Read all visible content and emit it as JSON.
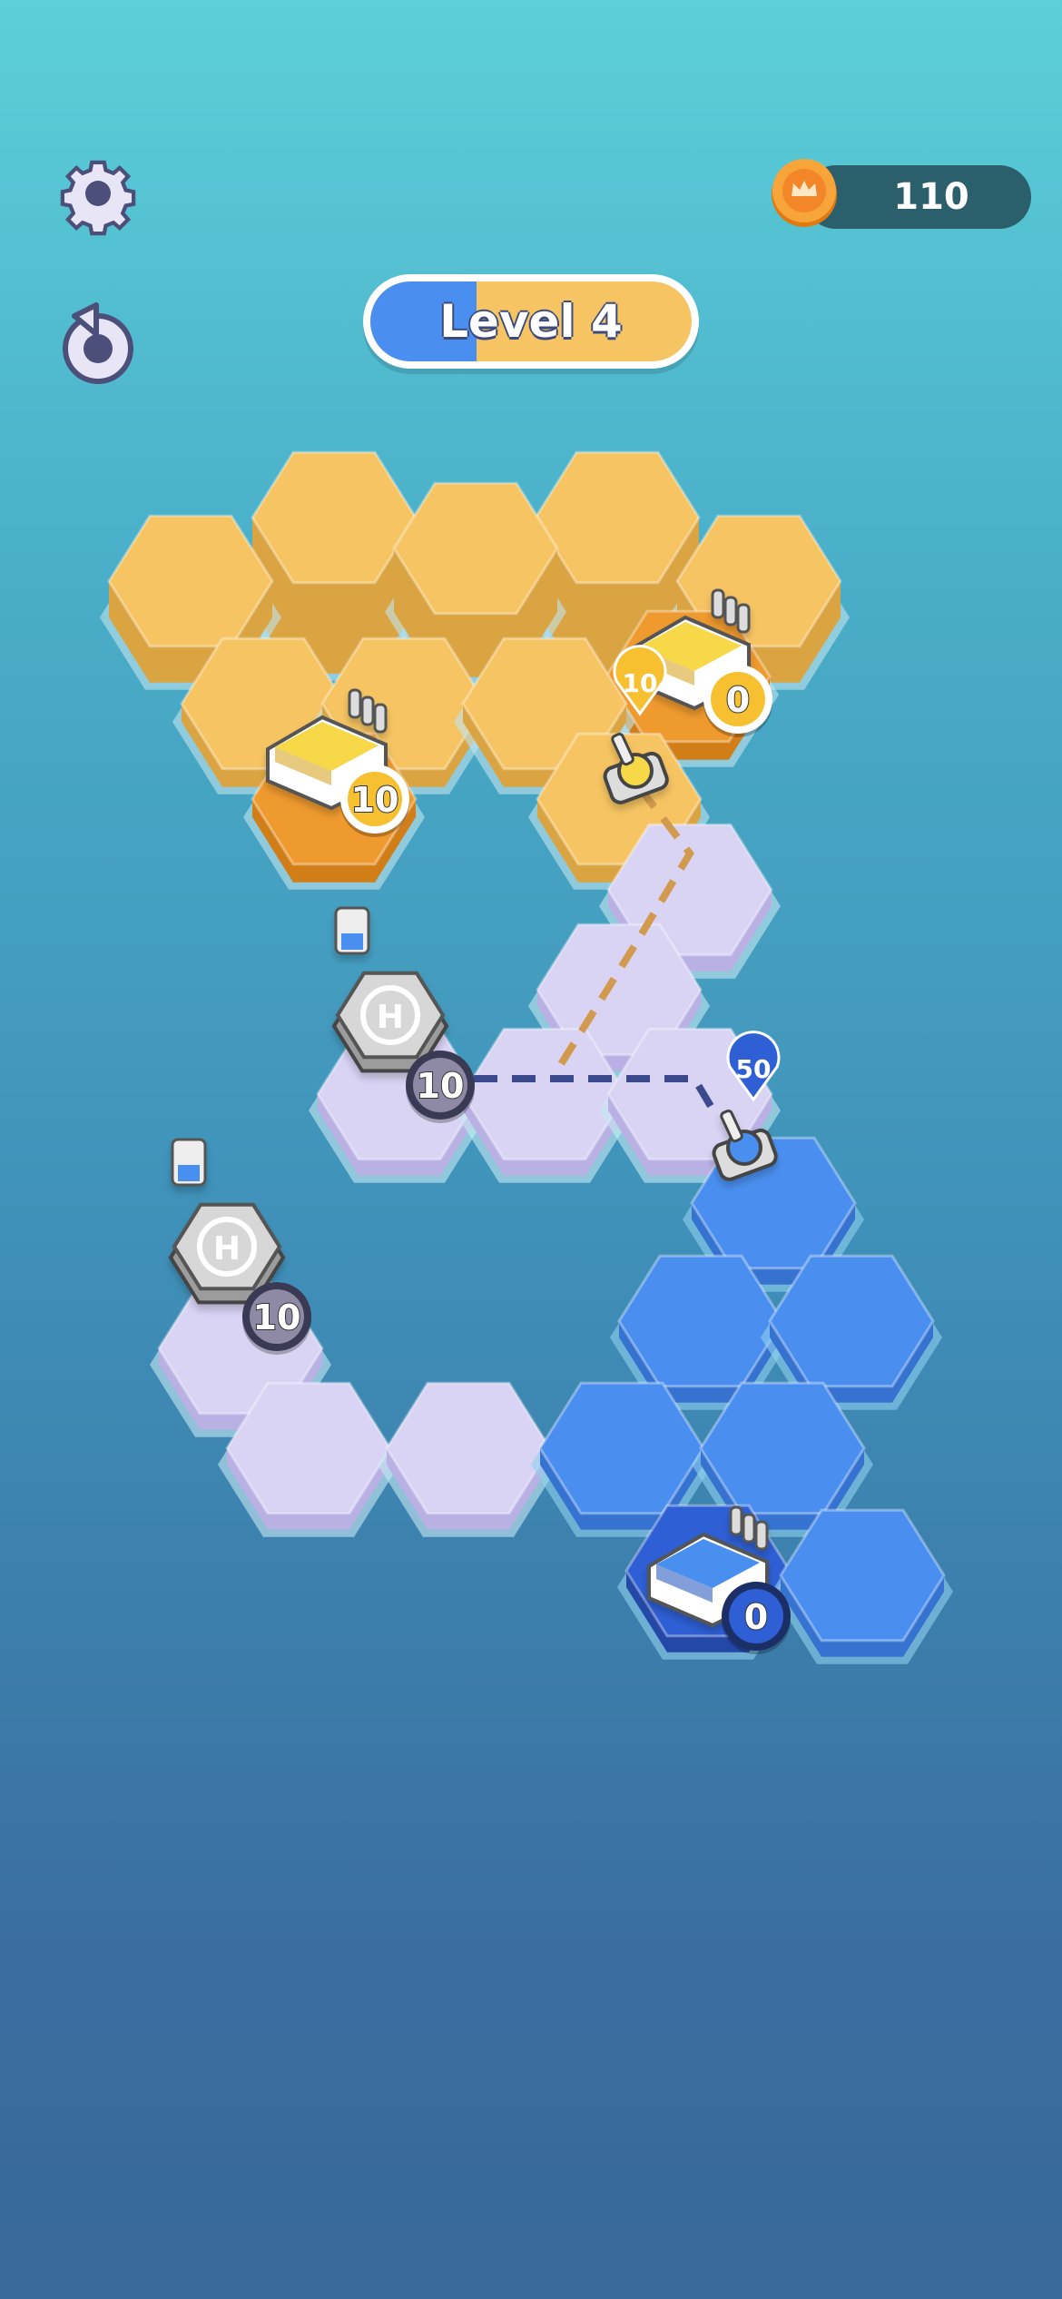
{
  "hud": {
    "settings_icon": "gear-icon",
    "restart_icon": "restart-icon",
    "coins": "110",
    "coin_icon": "crown-coin-icon",
    "level_label": "Level 4",
    "level_progress": 0.33
  },
  "colors": {
    "yellow_team": "#f6c462",
    "blue_team": "#4a8ff0",
    "neutral": "#d9d3f4"
  },
  "board": {
    "bases": [
      {
        "team": "yellow",
        "count": "10",
        "icon": "factory-icon"
      },
      {
        "team": "yellow",
        "count": "0",
        "icon": "factory-icon"
      },
      {
        "team": "blue",
        "count": "0",
        "icon": "factory-icon"
      }
    ],
    "helipads": [
      {
        "count": "10",
        "icon": "helipad-icon"
      },
      {
        "count": "10",
        "icon": "helipad-icon"
      }
    ],
    "units": [
      {
        "team": "yellow",
        "strength": "10",
        "icon": "tank-icon"
      },
      {
        "team": "blue",
        "strength": "50",
        "icon": "tank-icon"
      }
    ]
  }
}
